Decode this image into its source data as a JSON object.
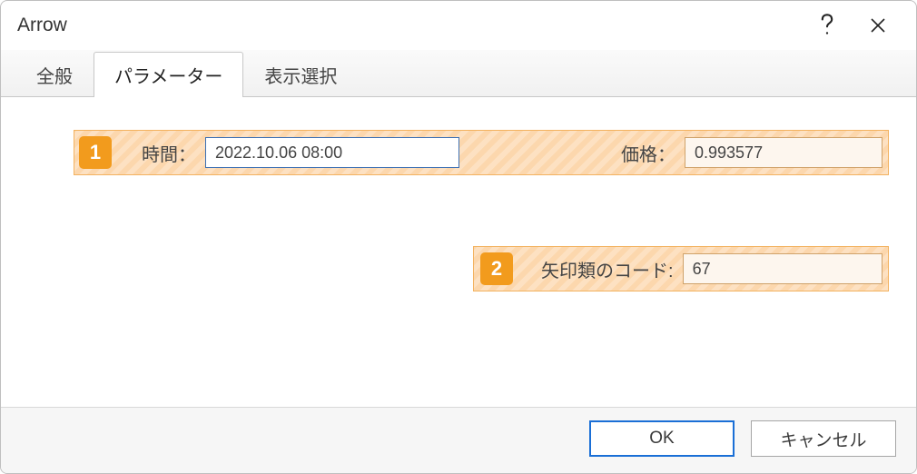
{
  "window": {
    "title": "Arrow"
  },
  "tabs": {
    "general": "全般",
    "parameters": "パラメーター",
    "display": "表示選択"
  },
  "callouts": {
    "one": "1",
    "two": "2"
  },
  "fields": {
    "time_label": "時間：",
    "time_value": "2022.10.06 08:00",
    "price_label": "価格：",
    "price_value": "0.993577",
    "arrowcode_label": "矢印類のコード:",
    "arrowcode_value": "67"
  },
  "buttons": {
    "ok": "OK",
    "cancel": "キャンセル"
  }
}
